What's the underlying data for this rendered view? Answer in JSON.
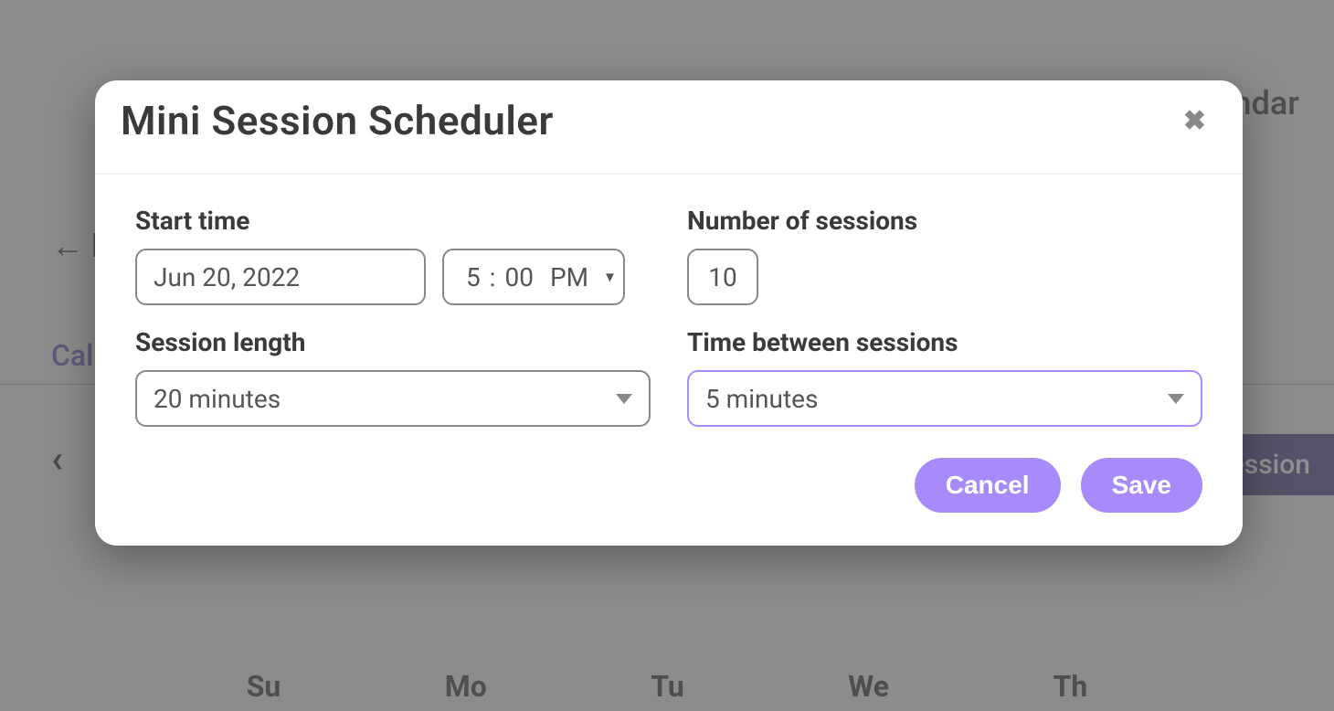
{
  "background": {
    "topRight": "ndar",
    "back": "B",
    "calendar": "Cal",
    "sessionButton": "Session",
    "days": {
      "su": "Su",
      "mo": "Mo",
      "tu": "Tu",
      "we": "We",
      "th": "Th"
    }
  },
  "modal": {
    "title": "Mini Session Scheduler",
    "labels": {
      "startTime": "Start time",
      "numberOfSessions": "Number of sessions",
      "sessionLength": "Session length",
      "timeBetween": "Time between sessions"
    },
    "values": {
      "date": "Jun 20, 2022",
      "hour": "5",
      "minute": "00",
      "ampm": "PM",
      "sessionCount": "10",
      "sessionLength": "20 minutes",
      "timeBetween": "5 minutes"
    },
    "buttons": {
      "cancel": "Cancel",
      "save": "Save"
    }
  }
}
